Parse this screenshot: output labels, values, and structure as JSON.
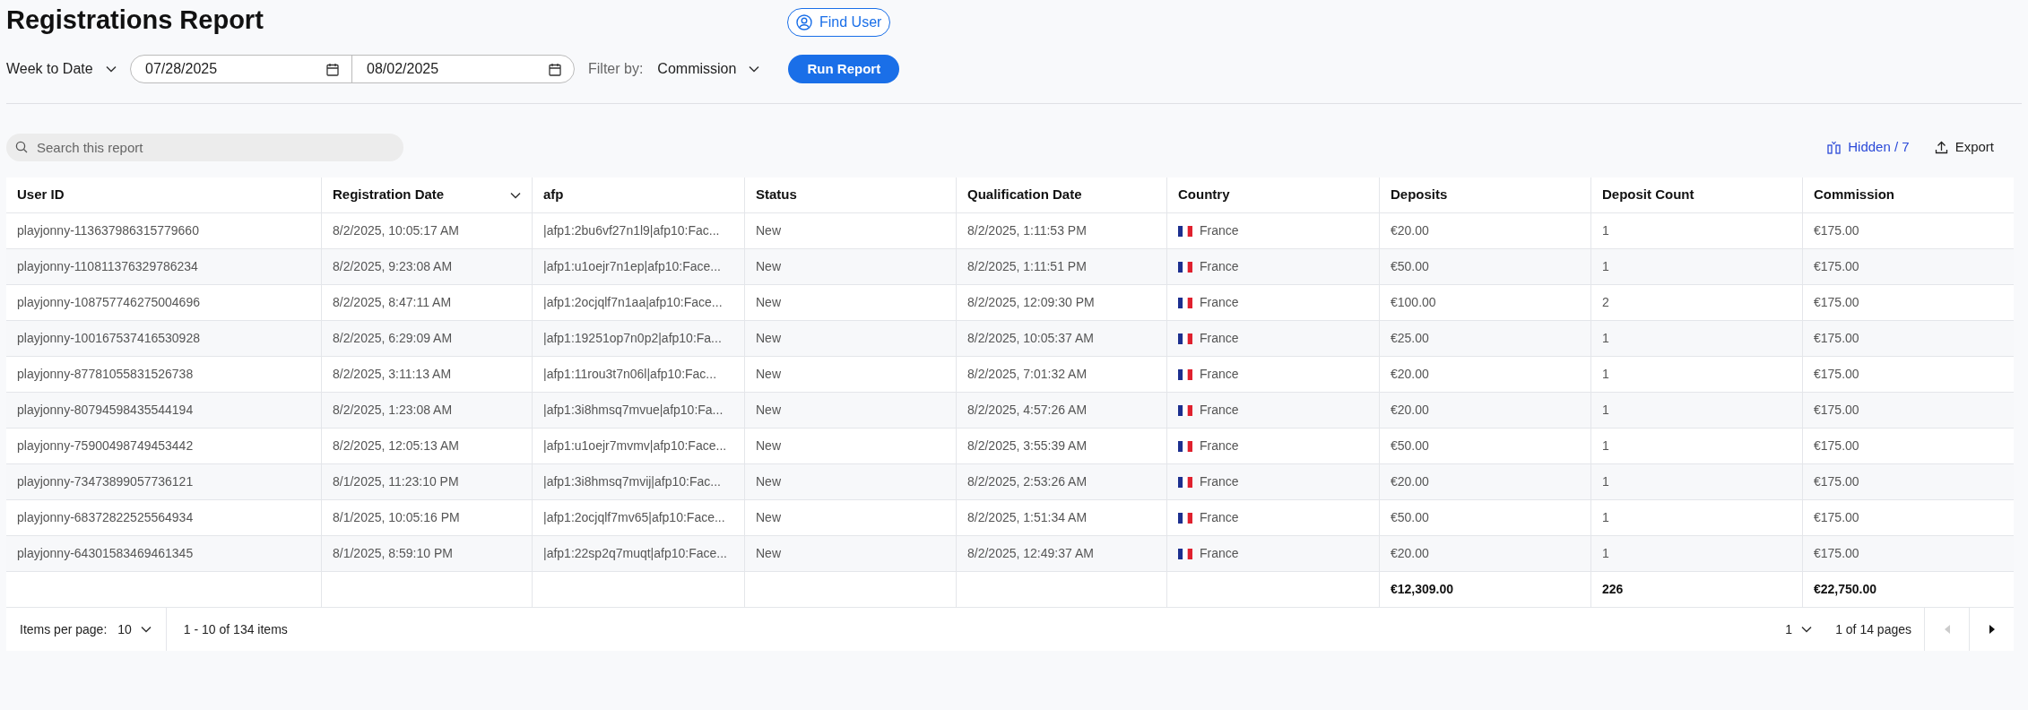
{
  "title": "Registrations Report",
  "find_user": {
    "label": "Find User"
  },
  "period": {
    "label": "Week to Date"
  },
  "date_range": {
    "start": "07/28/2025",
    "end": "08/02/2025"
  },
  "filter": {
    "label": "Filter by:",
    "value": "Commission"
  },
  "run_button": {
    "label": "Run Report"
  },
  "search": {
    "placeholder": "Search this report"
  },
  "hidden_columns": {
    "label": "Hidden / 7"
  },
  "export": {
    "label": "Export"
  },
  "table": {
    "columns": [
      {
        "label": "User ID",
        "sorted": false
      },
      {
        "label": "Registration Date",
        "sorted": true
      },
      {
        "label": "afp",
        "sorted": false
      },
      {
        "label": "Status",
        "sorted": false
      },
      {
        "label": "Qualification Date",
        "sorted": false
      },
      {
        "label": "Country",
        "sorted": false
      },
      {
        "label": "Deposits",
        "sorted": false
      },
      {
        "label": "Deposit Count",
        "sorted": false
      },
      {
        "label": "Commission",
        "sorted": false
      }
    ],
    "rows": [
      {
        "cells": [
          "playjonny-113637986315779660",
          "8/2/2025, 10:05:17 AM",
          "|afp1:2bu6vf27n1l9|afp10:Fac...",
          "New",
          "8/2/2025, 1:11:53 PM",
          "France",
          "€20.00",
          "1",
          "€175.00"
        ]
      },
      {
        "cells": [
          "playjonny-110811376329786234",
          "8/2/2025, 9:23:08 AM",
          "|afp1:u1oejr7n1ep|afp10:Face...",
          "New",
          "8/2/2025, 1:11:51 PM",
          "France",
          "€50.00",
          "1",
          "€175.00"
        ]
      },
      {
        "cells": [
          "playjonny-108757746275004696",
          "8/2/2025, 8:47:11 AM",
          "|afp1:2ocjqlf7n1aa|afp10:Face...",
          "New",
          "8/2/2025, 12:09:30 PM",
          "France",
          "€100.00",
          "2",
          "€175.00"
        ]
      },
      {
        "cells": [
          "playjonny-100167537416530928",
          "8/2/2025, 6:29:09 AM",
          "|afp1:19251op7n0p2|afp10:Fa...",
          "New",
          "8/2/2025, 10:05:37 AM",
          "France",
          "€25.00",
          "1",
          "€175.00"
        ]
      },
      {
        "cells": [
          "playjonny-87781055831526738",
          "8/2/2025, 3:11:13 AM",
          "|afp1:11rou3t7n06l|afp10:Fac...",
          "New",
          "8/2/2025, 7:01:32 AM",
          "France",
          "€20.00",
          "1",
          "€175.00"
        ]
      },
      {
        "cells": [
          "playjonny-80794598435544194",
          "8/2/2025, 1:23:08 AM",
          "|afp1:3i8hmsq7mvue|afp10:Fa...",
          "New",
          "8/2/2025, 4:57:26 AM",
          "France",
          "€20.00",
          "1",
          "€175.00"
        ]
      },
      {
        "cells": [
          "playjonny-75900498749453442",
          "8/2/2025, 12:05:13 AM",
          "|afp1:u1oejr7mvmv|afp10:Face...",
          "New",
          "8/2/2025, 3:55:39 AM",
          "France",
          "€50.00",
          "1",
          "€175.00"
        ]
      },
      {
        "cells": [
          "playjonny-73473899057736121",
          "8/1/2025, 11:23:10 PM",
          "|afp1:3i8hmsq7mvij|afp10:Fac...",
          "New",
          "8/2/2025, 2:53:26 AM",
          "France",
          "€20.00",
          "1",
          "€175.00"
        ]
      },
      {
        "cells": [
          "playjonny-68372822525564934",
          "8/1/2025, 10:05:16 PM",
          "|afp1:2ocjqlf7mv65|afp10:Face...",
          "New",
          "8/2/2025, 1:51:34 AM",
          "France",
          "€50.00",
          "1",
          "€175.00"
        ]
      },
      {
        "cells": [
          "playjonny-64301583469461345",
          "8/1/2025, 8:59:10 PM",
          "|afp1:22sp2q7muqt|afp10:Face...",
          "New",
          "8/2/2025, 12:49:37 AM",
          "France",
          "€20.00",
          "1",
          "€175.00"
        ]
      }
    ],
    "totals": {
      "deposits": "€12,309.00",
      "deposit_count": "226",
      "commission": "€22,750.00"
    }
  },
  "pagination": {
    "items_label": "Items per page:",
    "items_value": "10",
    "range": "1 - 10 of 134 items",
    "page": "1",
    "pages": "1 of 14 pages",
    "prev_disabled": true,
    "next_disabled": false
  }
}
